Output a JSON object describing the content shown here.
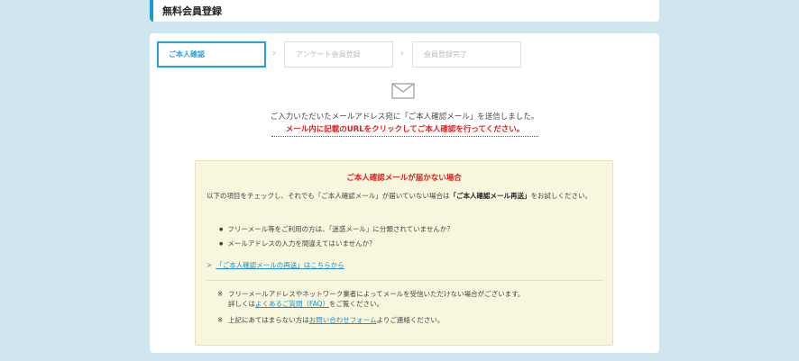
{
  "header": {
    "title": "無料会員登録"
  },
  "steps": [
    {
      "label": "ご本人確認"
    },
    {
      "label": "アンケート会員登録"
    },
    {
      "label": "会員登録完了"
    }
  ],
  "step_separator": "›",
  "message": {
    "sent": "ご入力いただいたメールアドレス宛に「ご本人確認メール」を送信しました。",
    "click": "メール内に記載のURLをクリックしてご本人確認を行ってください。"
  },
  "help": {
    "title": "ご本人確認メールが届かない場合",
    "intro_before": "以下の項目をチェックし、それでも「ご本人確認メール」が届いていない場合は",
    "intro_bold": "「ご本人確認メール再送」",
    "intro_after": "をお試しください。",
    "bullets": [
      "フリーメール等をご利用の方は、「迷惑メール」に分類されていませんか？",
      "メールアドレスの入力を間違えてはいませんか？"
    ],
    "resend_chevron": ">",
    "resend_link": "「ご本人確認メールの再送」はこちらから",
    "note_mark": "※",
    "note1_line1": "フリーメールアドレスやネットワーク業者によってメールを受信いただけない場合がございます。",
    "note1_prefix": "詳しくは",
    "note1_link": "よくあるご質問（FAQ）",
    "note1_suffix": "をご覧ください。",
    "note2_prefix": "上記にあてはまらない方は",
    "note2_link": "お問い合わせフォーム",
    "note2_suffix": "よりご連絡ください。"
  },
  "colors": {
    "accent": "#2a9fd8",
    "alert": "#e02020",
    "help_bg": "#f8f6dd",
    "page_bg": "#cfe6ef"
  }
}
